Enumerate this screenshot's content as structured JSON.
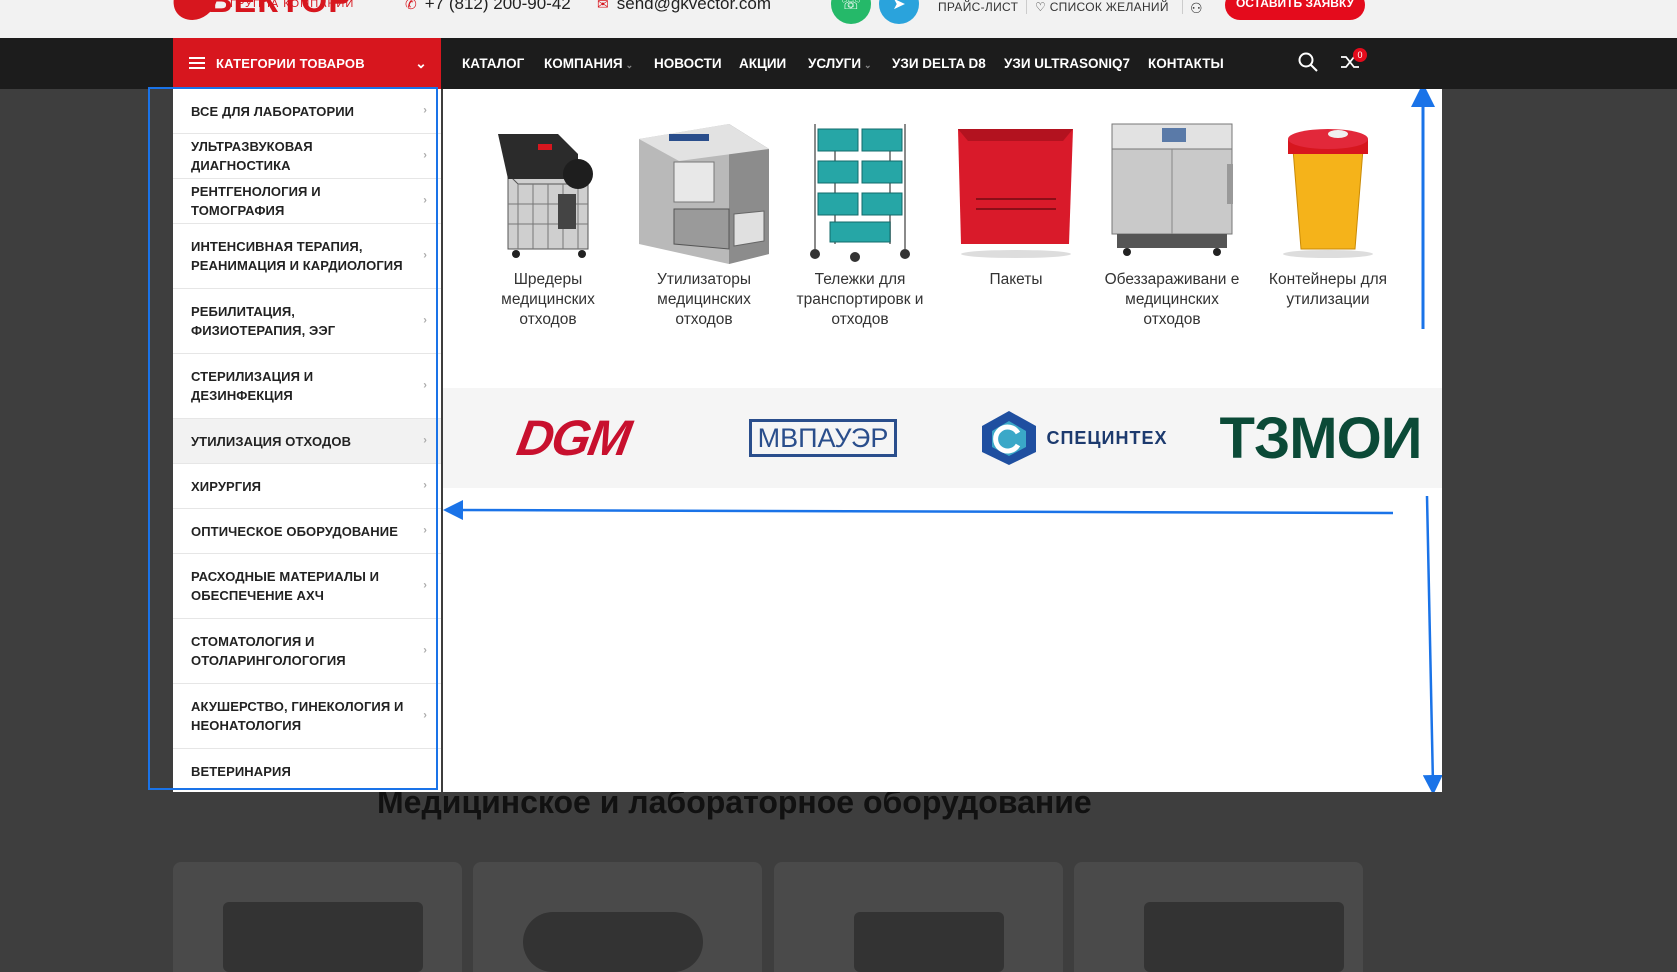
{
  "header": {
    "logo_word": "ВЕКТОР",
    "logo_sub": "ГРУППА КОМПАНИЙ",
    "phone": "+7 (812) 200-90-42",
    "email": "send@gkvector.com",
    "price_list": "ПРАЙС-ЛИСТ",
    "wishlist": "СПИСОК ЖЕЛАНИЙ",
    "request_button": "ОСТАВИТЬ ЗАЯВКУ",
    "whatsapp_color": "#25b969",
    "telegram_color": "#2aa3dc"
  },
  "nav": {
    "categories_button": "КАТЕГОРИИ ТОВАРОВ",
    "items": [
      {
        "label": "КАТАЛОГ"
      },
      {
        "label": "КОМПАНИЯ"
      },
      {
        "label": "НОВОСТИ"
      },
      {
        "label": "АКЦИИ"
      },
      {
        "label": "УСЛУГИ"
      },
      {
        "label": "УЗИ DELTA D8"
      },
      {
        "label": "УЗИ ULTRASONIQ7"
      },
      {
        "label": "КОНТАКТЫ"
      }
    ],
    "compare_count": "0"
  },
  "menu": {
    "items": [
      {
        "label": "ВСЕ ДЛЯ ЛАБОРАТОРИИ"
      },
      {
        "label": "УЛЬТРАЗВУКОВАЯ ДИАГНОСТИКА"
      },
      {
        "label": "РЕНТГЕНОЛОГИЯ И ТОМОГРАФИЯ"
      },
      {
        "label": "ИНТЕНСИВНАЯ ТЕРАПИЯ, РЕАНИМАЦИЯ И КАРДИОЛОГИЯ"
      },
      {
        "label": "РЕБИЛИТАЦИЯ, ФИЗИОТЕРАПИЯ, ЭЭГ"
      },
      {
        "label": "СТЕРИЛИЗАЦИЯ И ДЕЗИНФЕКЦИЯ"
      },
      {
        "label": "УТИЛИЗАЦИЯ ОТХОДОВ"
      },
      {
        "label": "ХИРУРГИЯ"
      },
      {
        "label": "ОПТИЧЕСКОЕ ОБОРУДОВАНИЕ"
      },
      {
        "label": "РАСХОДНЫЕ МАТЕРИАЛЫ И ОБЕСПЕЧЕНИЕ АХЧ"
      },
      {
        "label": "СТОМАТОЛОГИЯ И ОТОЛАРИНГОЛОГОГИЯ"
      },
      {
        "label": "АКУШЕРСТВО, ГИНЕКОЛОГИЯ И НЕОНАТОЛОГИЯ"
      },
      {
        "label": "ВЕТЕРИНАРИЯ"
      }
    ]
  },
  "mega": {
    "products": [
      {
        "name": "Шредеры медицинских отходов"
      },
      {
        "name": "Утилизаторы медицинских отходов"
      },
      {
        "name": "Тележки для транспортировк и отходов"
      },
      {
        "name": "Пакеты"
      },
      {
        "name": "Обеззараживани е медицинских отходов"
      },
      {
        "name": "Контейнеры для утилизации"
      }
    ],
    "brands": [
      {
        "name": "DGM"
      },
      {
        "name": "МВПАУЭР"
      },
      {
        "name": "СПЕЦИНТЕХ"
      },
      {
        "name": "ТЗМОИ"
      }
    ]
  },
  "page": {
    "section_title": "Медицинское и лабораторное оборудование"
  }
}
